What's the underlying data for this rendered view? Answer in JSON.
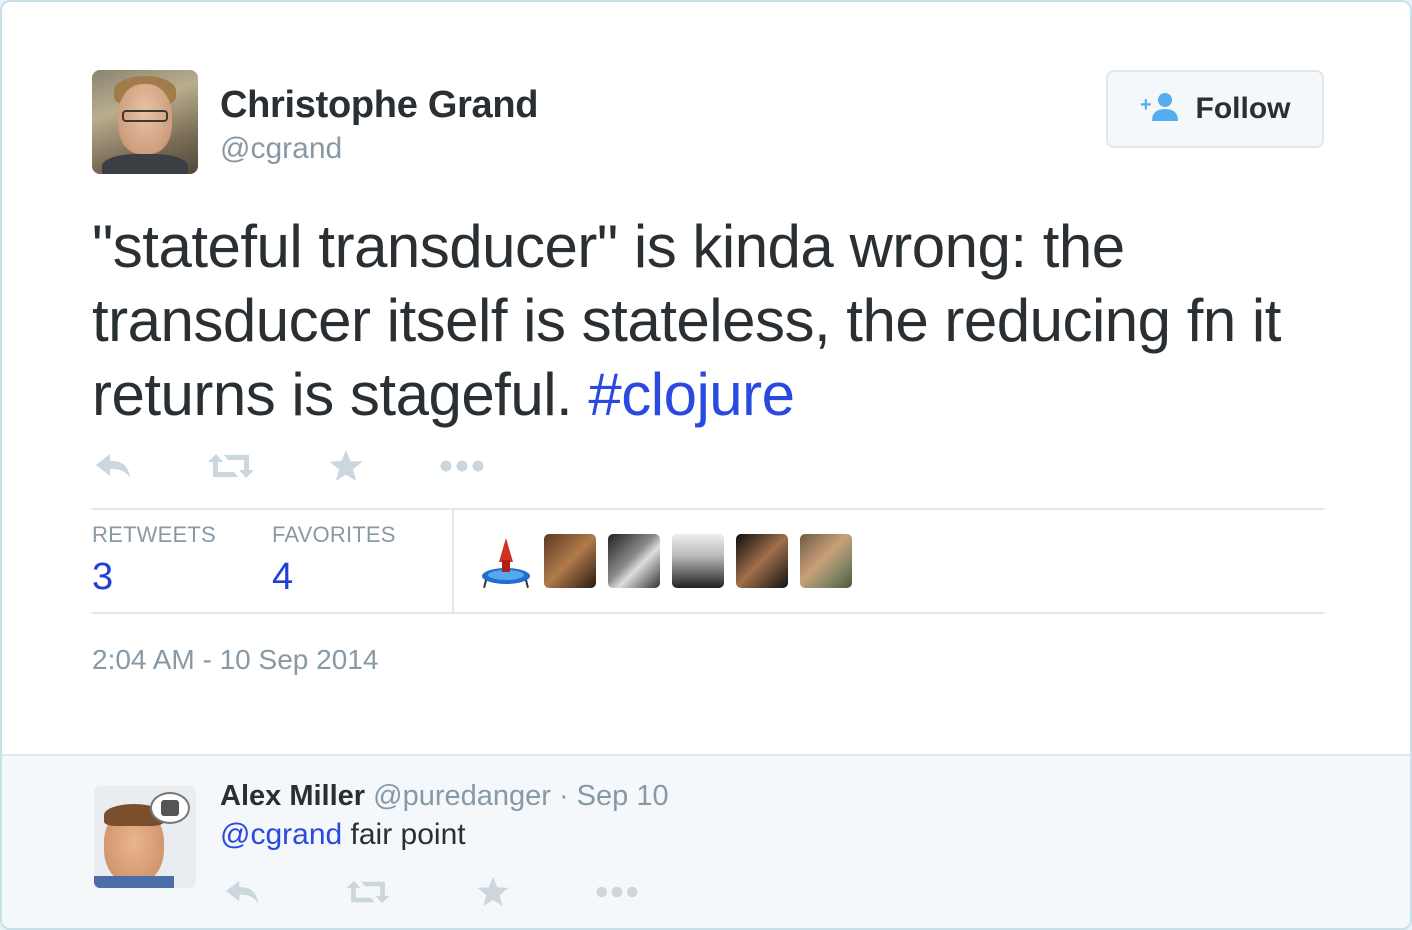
{
  "author": {
    "name": "Christophe Grand",
    "handle": "@cgrand"
  },
  "follow_button": {
    "label": "Follow",
    "icon": "add-user-icon"
  },
  "tweet": {
    "text": "\"stateful transducer\" is kinda wrong: the transducer itself is stateless, the reducing fn it returns is stageful. ",
    "hashtag": "#clojure"
  },
  "actions": [
    {
      "icon": "reply-icon"
    },
    {
      "icon": "retweet-icon"
    },
    {
      "icon": "favorite-star-icon"
    },
    {
      "icon": "more-dots-icon"
    }
  ],
  "stats": {
    "retweets_label": "RETWEETS",
    "retweets_count": "3",
    "favorites_label": "FAVORITES",
    "favorites_count": "4"
  },
  "facepile": [
    {
      "icon": "trampoline-rocket-avatar"
    },
    {
      "icon": "user-avatar"
    },
    {
      "icon": "user-avatar"
    },
    {
      "icon": "user-avatar"
    },
    {
      "icon": "user-avatar"
    },
    {
      "icon": "horse-avatar"
    }
  ],
  "timestamp": "2:04 AM - 10 Sep 2014",
  "reply": {
    "name": "Alex Miller",
    "meta": "@puredanger · Sep 10",
    "mention": "@cgrand",
    "text": " fair point"
  },
  "colors": {
    "link": "#2a49e0",
    "muted": "#8899a6",
    "text": "#292f33",
    "follow_icon": "#55acee"
  }
}
